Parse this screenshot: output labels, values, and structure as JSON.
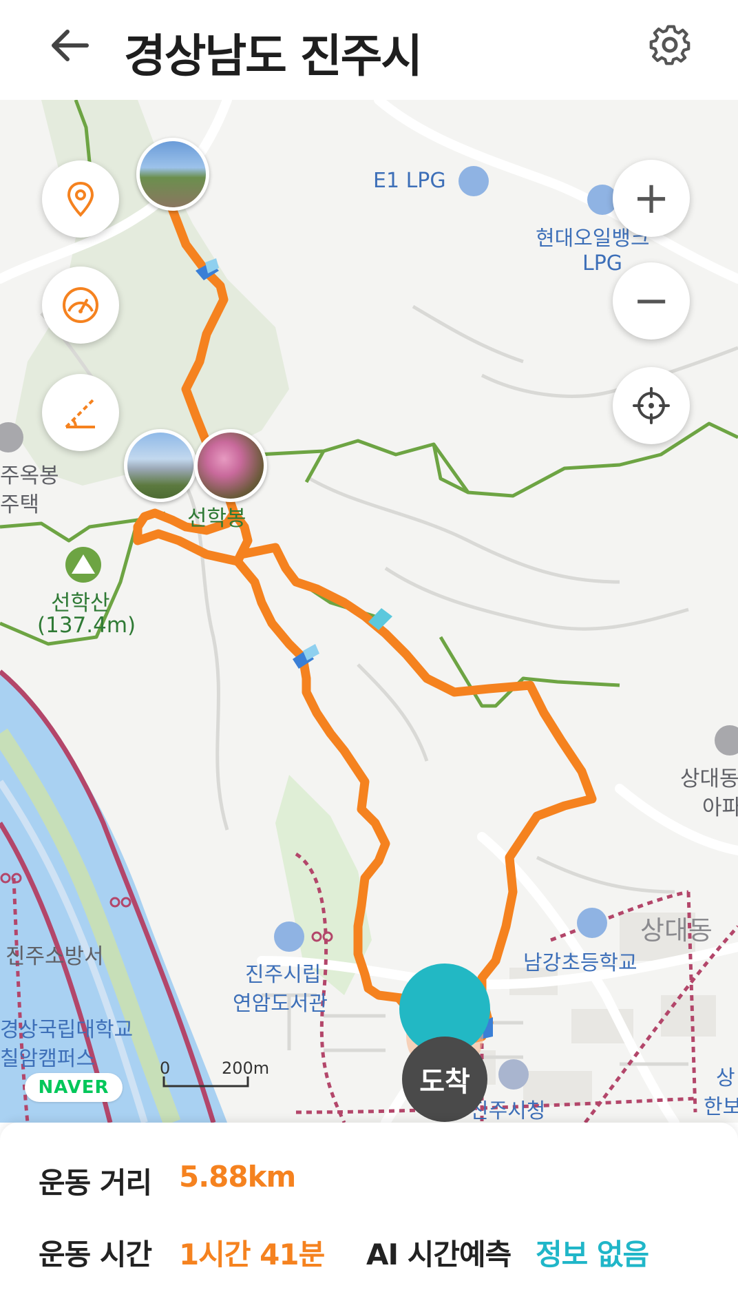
{
  "header": {
    "title": "경상남도 진주시",
    "back_icon": "arrow-left-icon",
    "settings_icon": "gear-icon"
  },
  "map": {
    "controls": {
      "left": [
        "location-pin-icon",
        "speedometer-icon",
        "slope-angle-icon"
      ],
      "zoom_in_label": "+",
      "zoom_out_label": "−",
      "recenter_icon": "crosshair-icon"
    },
    "labels": {
      "e1_lpg": "E1 LPG",
      "hyundai_lpg_line1": "현대오일뱅크",
      "hyundai_lpg_line2": "LPG",
      "left_top_line1": "주옥봉",
      "left_top_line2": "주택",
      "seonhakbong": "선학봉",
      "seonhaksan": "선학산",
      "seonhaksan_height": "(137.4m)",
      "sangdae_apt_line1": "상대동",
      "sangdae_apt_line2": "아파",
      "sangdae_dong": "상대동",
      "namgang_school": "남강초등학교",
      "library_line1": "진주시립",
      "library_line2": "연암도서관",
      "fire_station": "진주소방서",
      "university_line1": "경상국립대학교",
      "university_line2": "칠암캠퍼스",
      "city_hall": "진주시청",
      "right_edge_line1": "상",
      "right_edge_line2": "한보",
      "destination": "도착"
    },
    "brand": "NAVER",
    "scale_zero": "0",
    "scale_label": "200m",
    "colors": {
      "route": "#f5821f",
      "trail": "#6da443",
      "river": "#a9d1f2",
      "railway": "#b3466a"
    }
  },
  "stats": {
    "distance_label": "운동 거리",
    "distance_value": "5.88km",
    "time_label": "운동 시간",
    "time_value": "1시간 41분",
    "ai_label": "AI 시간예측",
    "ai_value": "정보 없음"
  }
}
